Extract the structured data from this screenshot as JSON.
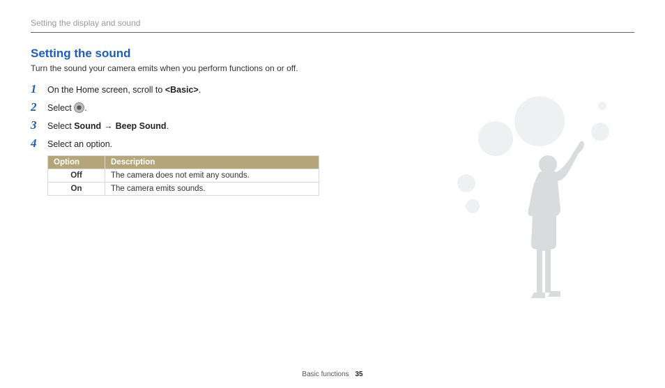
{
  "running_head": "Setting the display and sound",
  "section_title": "Setting the sound",
  "intro": "Turn the sound your camera emits when you perform functions on or off.",
  "steps": {
    "s1_pre": "On the Home screen, scroll to ",
    "s1_bold": "<Basic>",
    "s1_post": ".",
    "s2_pre": "Select ",
    "s2_post": ".",
    "s3_pre": "Select ",
    "s3_b1": "Sound",
    "s3_arrow": "→",
    "s3_b2": "Beep Sound",
    "s3_post": ".",
    "s4": "Select an option."
  },
  "table": {
    "h_option": "Option",
    "h_desc": "Description",
    "rows": [
      {
        "opt": "Off",
        "desc": "The camera does not emit any sounds."
      },
      {
        "opt": "On",
        "desc": "The camera emits sounds."
      }
    ]
  },
  "footer": {
    "section": "Basic functions",
    "page": "35"
  }
}
